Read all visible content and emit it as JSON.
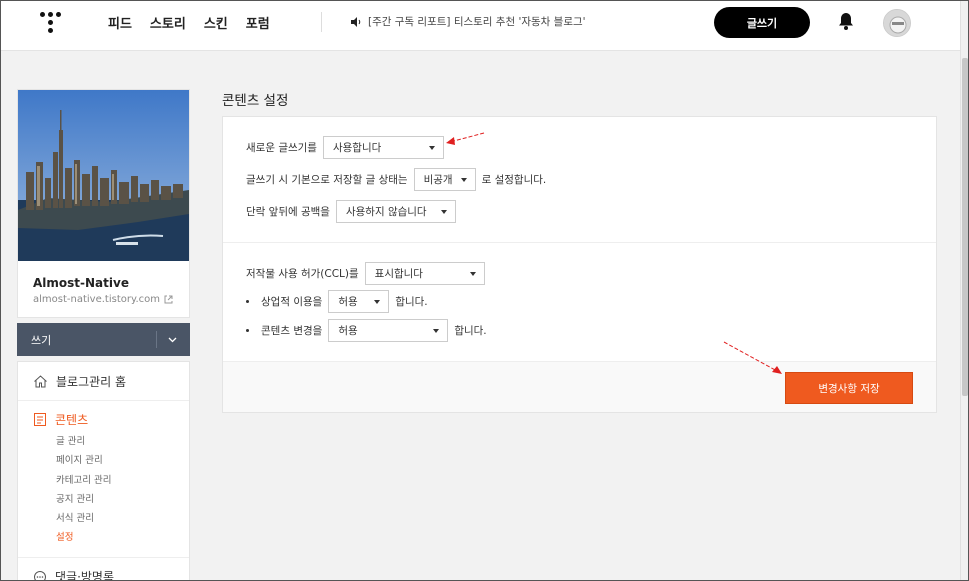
{
  "topbar": {
    "nav": [
      "피드",
      "스토리",
      "스킨",
      "포럼"
    ],
    "notice": "[주간 구독 리포트] 티스토리 추천 '자동차 블로그'",
    "write_label": "글쓰기",
    "icons": [
      "tistory-logo-icon",
      "speaker-icon",
      "bell-icon",
      "avatar"
    ]
  },
  "sidebar": {
    "blog_name": "Almost-Native",
    "blog_url": "almost-native.tistory.com",
    "write_dropdown": "쓰기",
    "home_label": "블로그관리 홈",
    "contents_label": "콘텐츠",
    "sub_items": [
      "글 관리",
      "페이지 관리",
      "카테고리 관리",
      "공지 관리",
      "서식 관리",
      "설정"
    ],
    "active_sub": "설정",
    "comments_label": "댓글·방명록"
  },
  "main": {
    "title": "콘텐츠 설정",
    "new_editor": {
      "label": "새로운 글쓰기를",
      "value": "사용합니다"
    },
    "default_save": {
      "prefix": "글쓰기 시 기본으로 저장할 글 상태는",
      "value": "비공개",
      "suffix": "로 설정합니다."
    },
    "paragraph_space": {
      "label": "단락 앞뒤에 공백을",
      "value": "사용하지 않습니다"
    },
    "ccl": {
      "label": "저작물 사용 허가(CCL)를",
      "value": "표시합니다"
    },
    "commercial": {
      "label": "상업적 이용을",
      "value": "허용",
      "suffix": "합니다."
    },
    "modify": {
      "label": "콘텐츠 변경을",
      "value": "허용",
      "suffix": "합니다."
    },
    "save_label": "변경사항 저장"
  },
  "colors": {
    "accent": "#ef5a1f",
    "dropdown_bg": "#4a5566",
    "arrow": "#e02020"
  }
}
